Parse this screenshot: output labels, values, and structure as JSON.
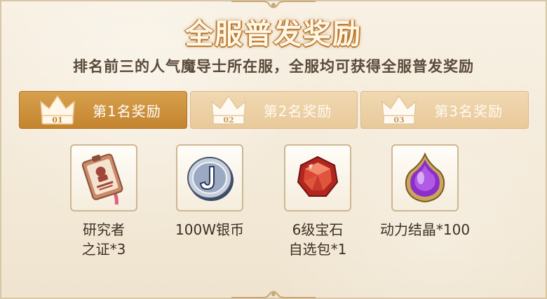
{
  "header": {
    "title": "全服普发奖励",
    "subtitle": "排名前三的人气魔导士所在服，全服均可获得全服普发奖励"
  },
  "tabs": [
    {
      "number": "01",
      "label": "第1名奖励",
      "active": true
    },
    {
      "number": "02",
      "label": "第2名奖励",
      "active": false
    },
    {
      "number": "03",
      "label": "第3名奖励",
      "active": false
    }
  ],
  "rewards": [
    {
      "icon": "researcher-badge-icon",
      "name": "研究者\n之证*3"
    },
    {
      "icon": "silver-coin-icon",
      "name": "100W银币"
    },
    {
      "icon": "gem-pack-icon",
      "name": "6级宝石\n自选包*1"
    },
    {
      "icon": "power-crystal-icon",
      "name": "动力结晶*100"
    }
  ],
  "colors": {
    "accent": "#c4842f",
    "tab_inactive": "#e8c99a",
    "text": "#3e3024"
  }
}
